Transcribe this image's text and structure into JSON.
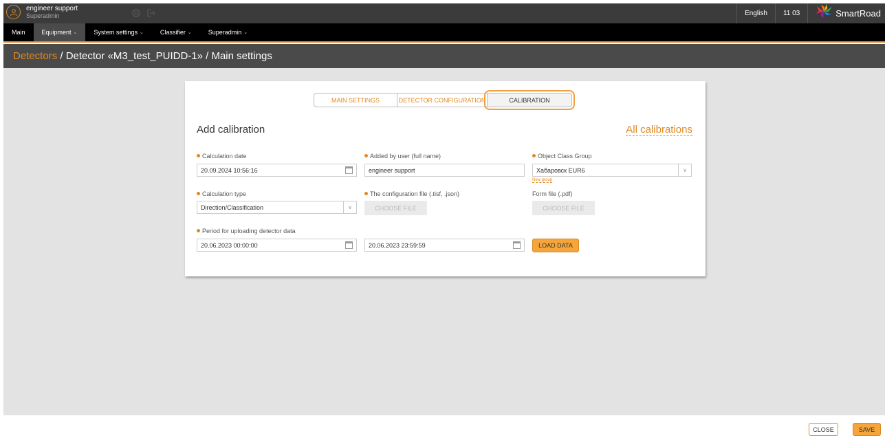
{
  "user": {
    "name": "engineer support",
    "role": "Superadmin"
  },
  "topbar": {
    "language": "English",
    "time": "11 03",
    "brand": "SmartRoad"
  },
  "menu": [
    {
      "label": "Main",
      "caret": ""
    },
    {
      "label": "Equipment",
      "caret": "⌄"
    },
    {
      "label": "System settings",
      "caret": "⌄"
    },
    {
      "label": "Classifier",
      "caret": "⌄"
    },
    {
      "label": "Superadmin",
      "caret": "⌄"
    }
  ],
  "breadcrumb": {
    "link": "Detectors",
    "rest": " / Detector «M3_test_PUIDD-1» / Main settings"
  },
  "tabs": [
    "MAIN SETTINGS",
    "DETECTOR CONFIGURATION",
    "CALIBRATION"
  ],
  "panel": {
    "title": "Add calibration",
    "all_calibrations": "All calibrations"
  },
  "form": {
    "calculation_date": {
      "label": "Calculation date",
      "value": "20.09.2024 10:56:16"
    },
    "added_by": {
      "label": "Added by user (full name)",
      "value": "engineer support"
    },
    "object_class_group": {
      "label": "Object Class Group",
      "value": "Хабаровск EUR6",
      "new_group": "New group"
    },
    "calculation_type": {
      "label": "Calculation type",
      "value": "Direction/Classification"
    },
    "config_file": {
      "label": "The configuration file (.tisf, .json)",
      "button": "CHOOSE FILE"
    },
    "form_file": {
      "label": "Form file (.pdf)",
      "button": "CHOOSE FILE"
    },
    "period": {
      "label": "Period for uploading detector data",
      "from": "20.06.2023 00:00:00",
      "to": "20.06.2023 23:59:59"
    },
    "load_button": "LOAD DATA"
  },
  "footer": {
    "close": "CLOSE",
    "save": "SAVE"
  },
  "colors": {
    "accent": "#e08a24",
    "button": "#f5a53a",
    "topbar": "#3b3b3b",
    "breadcrumb_bg": "#4a4a4a",
    "content_bg": "#e3e3e3"
  }
}
